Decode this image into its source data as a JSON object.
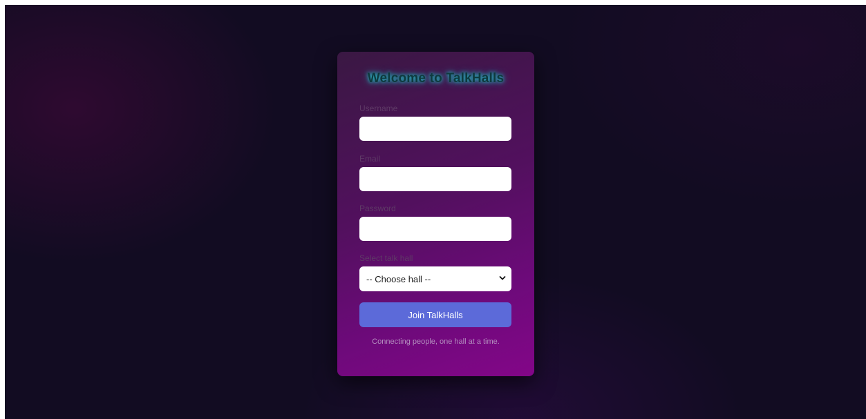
{
  "card": {
    "title": "Welcome to TalkHalls"
  },
  "form": {
    "username": {
      "label": "Username",
      "value": ""
    },
    "email": {
      "label": "Email",
      "value": ""
    },
    "password": {
      "label": "Password",
      "value": ""
    },
    "hall": {
      "label": "Select talk hall",
      "selected": "-- Choose hall --"
    },
    "submit_label": "Join TalkHalls"
  },
  "footer": {
    "tagline": "Connecting people, one hall at a time.",
    "link_text": ""
  },
  "colors": {
    "background": "#120c22",
    "card_gradient_start": "#3a1843",
    "card_gradient_end": "#830688",
    "title_glow": "#1fd6d6",
    "button": "#5c6ad9"
  },
  "icons": {
    "select_arrow": "chevron-down-icon"
  }
}
